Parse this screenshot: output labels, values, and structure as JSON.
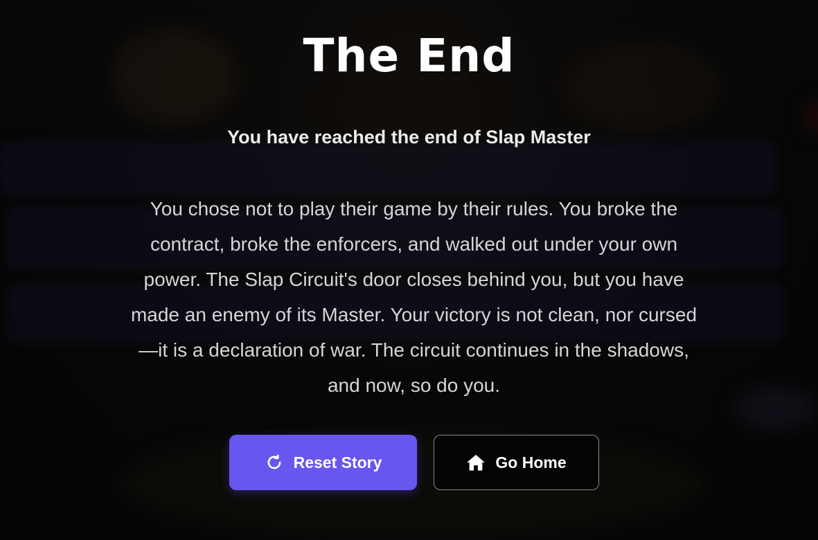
{
  "ending": {
    "title": "The End",
    "subtitle": "You have reached the end of Slap Master",
    "description": "You chose not to play their game by their rules. You broke the contract, broke the enforcers, and walked out under your own power. The Slap Circuit's door closes behind you, but you have made an enemy of its Master. Your victory is not clean, nor cursed—it is a declaration of war. The circuit continues in the shadows, and now, so do you."
  },
  "actions": {
    "reset": {
      "label": "Reset Story",
      "icon": "reset-icon"
    },
    "home": {
      "label": "Go Home",
      "icon": "home-icon"
    }
  },
  "colors": {
    "accent": "#6757ee",
    "title": "#ffffff",
    "body_text": "#d6d6d6"
  }
}
